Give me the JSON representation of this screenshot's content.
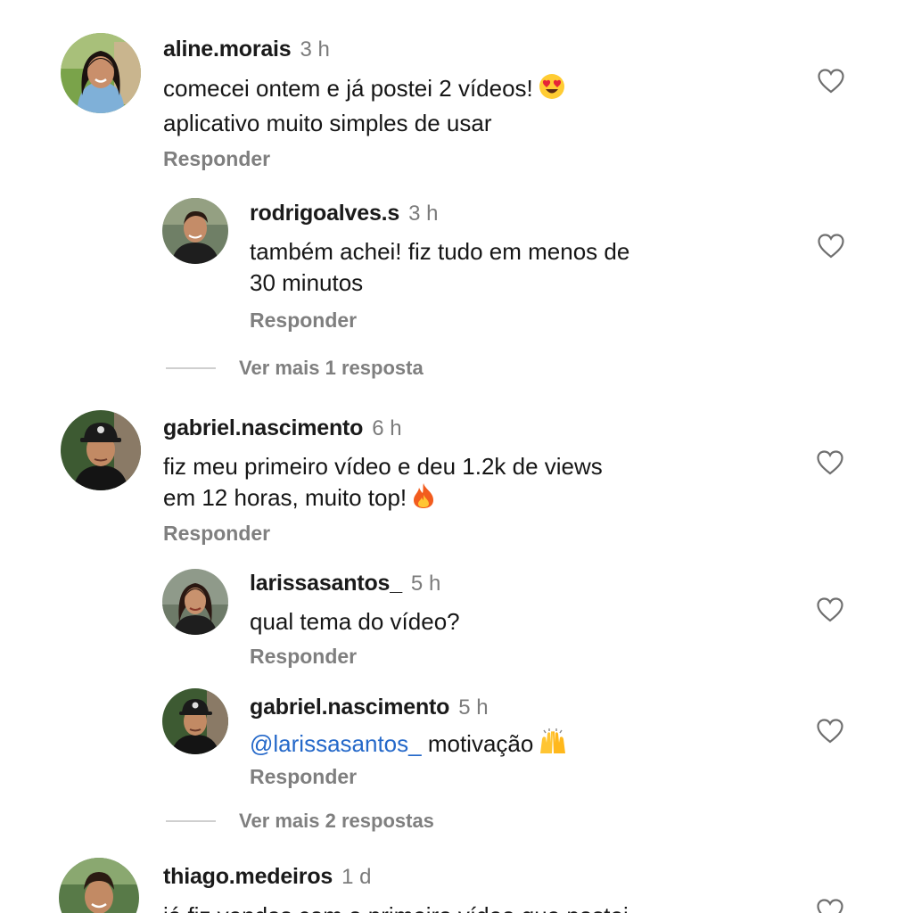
{
  "comments": [
    {
      "username": "aline.morais",
      "time": "3 h",
      "text_lines": [
        "comecei ontem e já postei 2 vídeos!",
        "aplicativo muito simples de usar"
      ],
      "emoji": "smiling-face-heart-eyes",
      "reply_label": "Responder",
      "replies": [
        {
          "username": "rodrigoalves.s",
          "time": "3 h",
          "text_lines": [
            "também achei! fiz tudo em menos de",
            "30 minutos"
          ],
          "reply_label": "Responder"
        }
      ],
      "more_replies_label": "Ver mais 1 resposta"
    },
    {
      "username": "gabriel.nascimento",
      "time": "6 h",
      "text_lines": [
        "fiz meu primeiro vídeo e deu 1.2k de views",
        "em 12 horas, muito top!"
      ],
      "emoji": "fire",
      "reply_label": "Responder",
      "replies": [
        {
          "username": "larissasantos_",
          "time": "5 h",
          "text_lines": [
            "qual tema do vídeo?"
          ],
          "reply_label": "Responder"
        },
        {
          "username": "gabriel.nascimento",
          "time": "5 h",
          "mention": "@larissasantos_",
          "text_after_mention": "motivação",
          "emoji": "raising-hands",
          "reply_label": "Responder"
        }
      ],
      "more_replies_label": "Ver mais 2 respostas"
    },
    {
      "username": "thiago.medeiros",
      "time": "1 d",
      "text_lines": [
        "já fiz vendas com o primeiro vídeo que postei"
      ]
    }
  ],
  "icons": {
    "like": "heart-outline-icon"
  },
  "colors": {
    "mention": "#2468c9",
    "muted": "#7f7f7f",
    "text": "#161616"
  }
}
